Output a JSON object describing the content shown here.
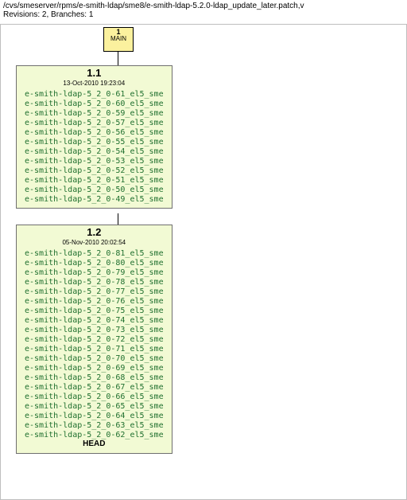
{
  "header": {
    "path": "/cvs/smeserver/rpms/e-smith-ldap/sme8/e-smith-ldap-5.2.0-ldap_update_later.patch,v",
    "meta": "Revisions: 2, Branches: 1"
  },
  "main": {
    "number": "1",
    "label": "MAIN"
  },
  "rev1": {
    "number": "1.1",
    "date": "13-Oct-2010 19:23:04",
    "tags": [
      "e-smith-ldap-5_2_0-61_el5_sme",
      "e-smith-ldap-5_2_0-60_el5_sme",
      "e-smith-ldap-5_2_0-59_el5_sme",
      "e-smith-ldap-5_2_0-57_el5_sme",
      "e-smith-ldap-5_2_0-56_el5_sme",
      "e-smith-ldap-5_2_0-55_el5_sme",
      "e-smith-ldap-5_2_0-54_el5_sme",
      "e-smith-ldap-5_2_0-53_el5_sme",
      "e-smith-ldap-5_2_0-52_el5_sme",
      "e-smith-ldap-5_2_0-51_el5_sme",
      "e-smith-ldap-5_2_0-50_el5_sme",
      "e-smith-ldap-5_2_0-49_el5_sme"
    ]
  },
  "rev2": {
    "number": "1.2",
    "date": "05-Nov-2010 20:02:54",
    "tags": [
      "e-smith-ldap-5_2_0-81_el5_sme",
      "e-smith-ldap-5_2_0-80_el5_sme",
      "e-smith-ldap-5_2_0-79_el5_sme",
      "e-smith-ldap-5_2_0-78_el5_sme",
      "e-smith-ldap-5_2_0-77_el5_sme",
      "e-smith-ldap-5_2_0-76_el5_sme",
      "e-smith-ldap-5_2_0-75_el5_sme",
      "e-smith-ldap-5_2_0-74_el5_sme",
      "e-smith-ldap-5_2_0-73_el5_sme",
      "e-smith-ldap-5_2_0-72_el5_sme",
      "e-smith-ldap-5_2_0-71_el5_sme",
      "e-smith-ldap-5_2_0-70_el5_sme",
      "e-smith-ldap-5_2_0-69_el5_sme",
      "e-smith-ldap-5_2_0-68_el5_sme",
      "e-smith-ldap-5_2_0-67_el5_sme",
      "e-smith-ldap-5_2_0-66_el5_sme",
      "e-smith-ldap-5_2_0-65_el5_sme",
      "e-smith-ldap-5_2_0-64_el5_sme",
      "e-smith-ldap-5_2_0-63_el5_sme",
      "e-smith-ldap-5_2_0-62_el5_sme"
    ],
    "head": "HEAD"
  }
}
